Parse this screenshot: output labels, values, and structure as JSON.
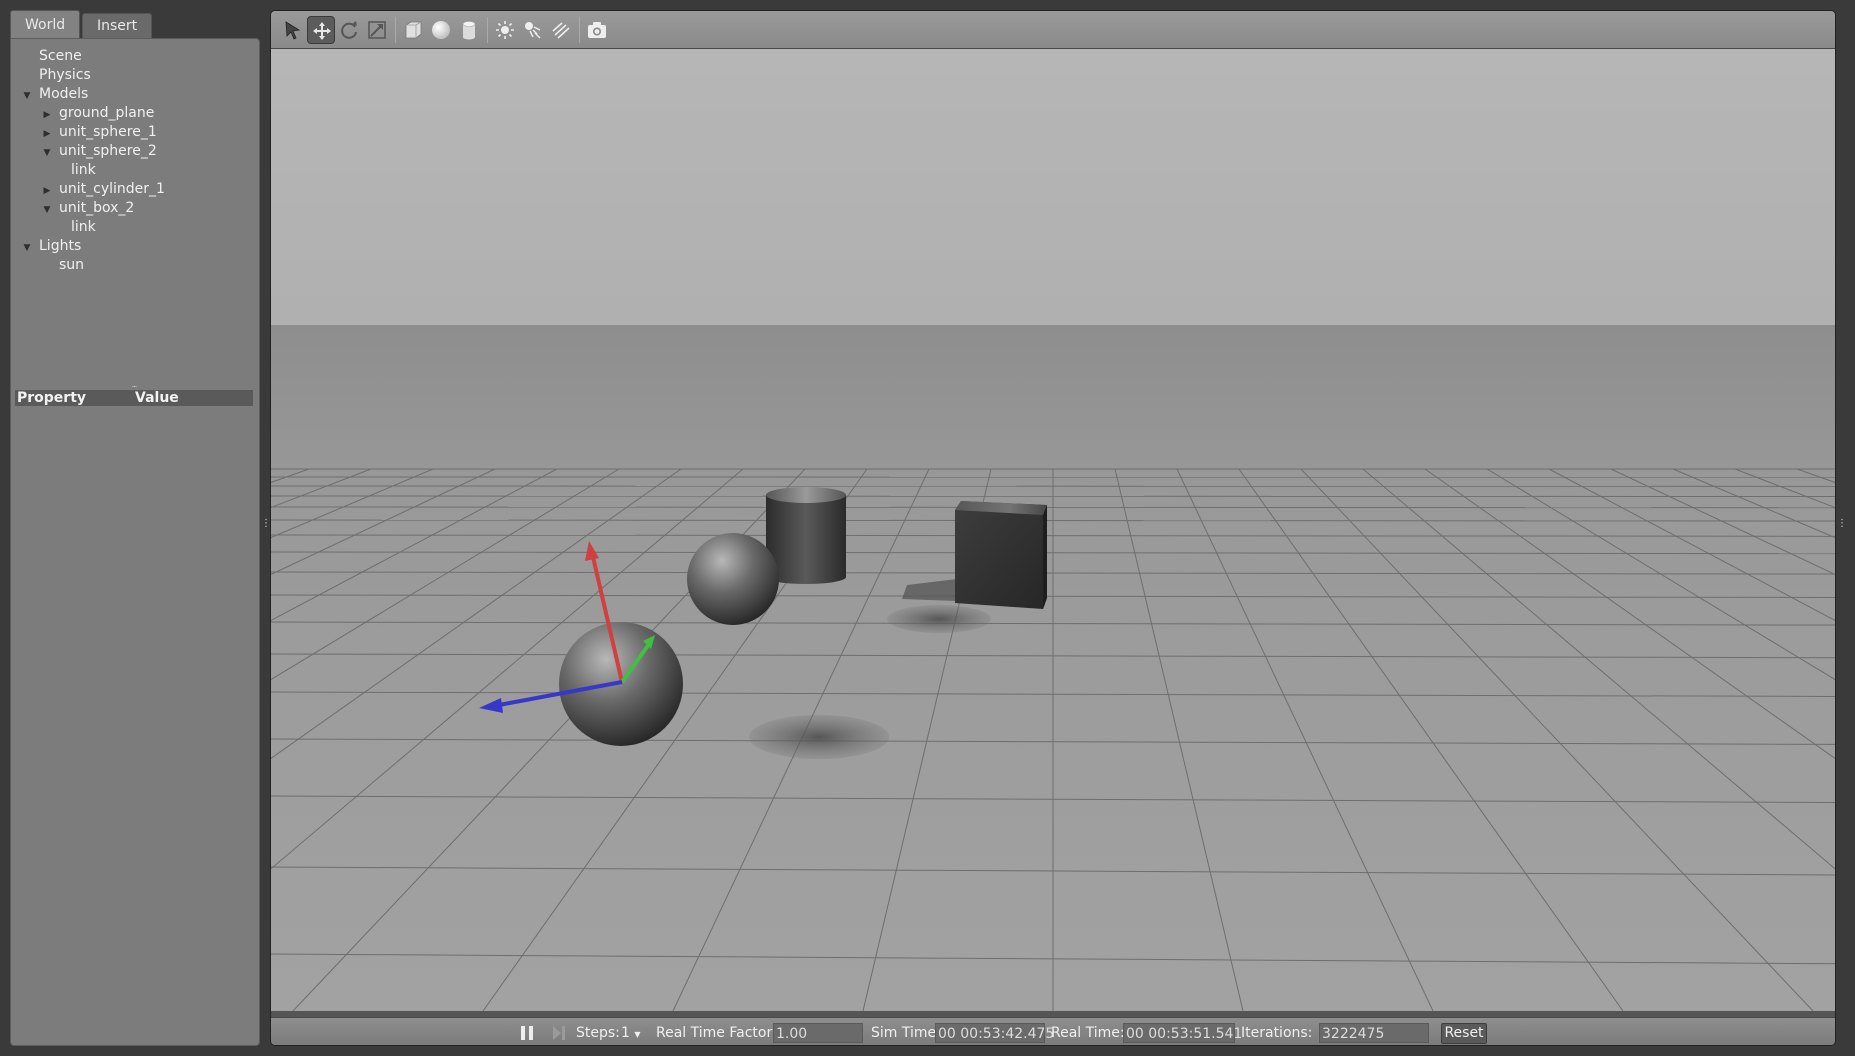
{
  "tabs": [
    {
      "label": "World",
      "active": true
    },
    {
      "label": "Insert",
      "active": false
    }
  ],
  "tree": {
    "scene": "Scene",
    "physics": "Physics",
    "models": "Models",
    "ground_plane": "ground_plane",
    "unit_sphere_1": "unit_sphere_1",
    "unit_sphere_2": "unit_sphere_2",
    "unit_sphere_2_link": "link",
    "unit_cylinder_1": "unit_cylinder_1",
    "unit_box_2": "unit_box_2",
    "unit_box_2_link": "link",
    "lights": "Lights",
    "sun": "sun"
  },
  "property_table": {
    "property_header": "Property",
    "value_header": "Value",
    "splitter": "..."
  },
  "toolbar": {
    "tools": [
      "select-icon",
      "translate-icon",
      "rotate-icon",
      "scale-icon",
      "box-icon",
      "sphere-icon",
      "cylinder-icon",
      "point-light-icon",
      "spot-light-icon",
      "directional-light-icon",
      "screenshot-icon"
    ],
    "active_tool": "translate-icon"
  },
  "statusbar": {
    "steps_label": "Steps:",
    "steps_value": "1",
    "rtf_label": "Real Time Factor:",
    "rtf_value": "1.00",
    "sim_time_label": "Sim Time:",
    "sim_time_value": "00 00:53:42.475",
    "real_time_label": "Real Time:",
    "real_time_value": "00 00:53:51.541",
    "iterations_label": "Iterations:",
    "iterations_value": "3222475",
    "reset_label": "Reset"
  },
  "colors": {
    "axis_x": "#d04040",
    "axis_y": "#40c040",
    "axis_z": "#3838c8",
    "sky": "#b4b4b4",
    "ground": "#9a9a9a"
  }
}
